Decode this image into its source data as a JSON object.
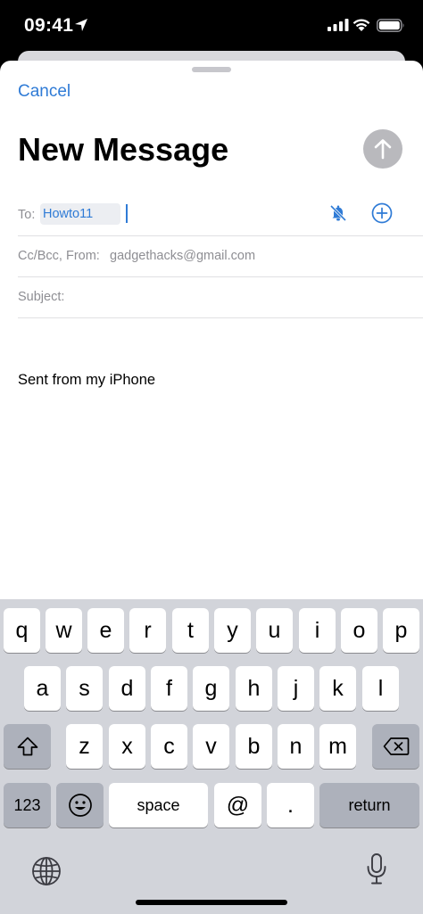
{
  "status_bar": {
    "time": "09:41"
  },
  "header": {
    "cancel_label": "Cancel",
    "title": "New Message"
  },
  "fields": {
    "to_label": "To:",
    "to_recipient": "Howto11",
    "cc_label": "Cc/Bcc, From:",
    "from_value": "gadgethacks@gmail.com",
    "subject_label": "Subject:"
  },
  "body": {
    "signature": "Sent from my iPhone"
  },
  "keyboard": {
    "row1": [
      "q",
      "w",
      "e",
      "r",
      "t",
      "y",
      "u",
      "i",
      "o",
      "p"
    ],
    "row2": [
      "a",
      "s",
      "d",
      "f",
      "g",
      "h",
      "j",
      "k",
      "l"
    ],
    "row3": [
      "z",
      "x",
      "c",
      "v",
      "b",
      "n",
      "m"
    ],
    "numbers_label": "123",
    "emoji_label": "☺",
    "space_label": "space",
    "at_label": "@",
    "period_label": ".",
    "return_label": "return"
  },
  "colors": {
    "accent": "#2f7bd6",
    "send_disabled": "#b9b9bd",
    "keyboard_bg": "#d2d4da"
  }
}
